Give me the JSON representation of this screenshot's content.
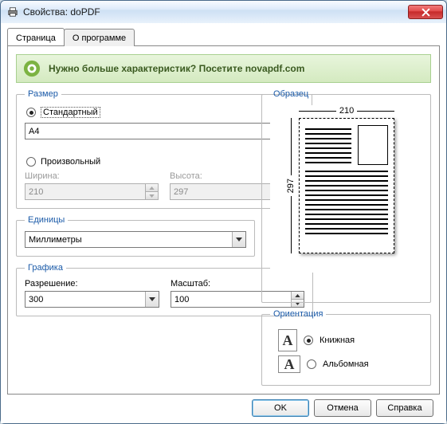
{
  "window": {
    "title": "Свойства: doPDF"
  },
  "tabs": {
    "page": "Страница",
    "about": "О программе"
  },
  "banner": {
    "text": "Нужно больше характеристик? Посетите ",
    "link": "novapdf.com"
  },
  "size": {
    "legend": "Размер",
    "standard_label": "Стандартный",
    "paper": "A4",
    "custom_label": "Произвольный",
    "width_label": "Ширина:",
    "width_value": "210",
    "height_label": "Высота:",
    "height_value": "297"
  },
  "units": {
    "legend": "Единицы",
    "value": "Миллиметры"
  },
  "graphics": {
    "legend": "Графика",
    "resolution_label": "Разрешение:",
    "resolution_value": "300",
    "scale_label": "Масштаб:",
    "scale_value": "100"
  },
  "sample": {
    "legend": "Образец",
    "width": "210",
    "height": "297"
  },
  "orientation": {
    "legend": "Ориентация",
    "portrait": "Книжная",
    "landscape": "Альбомная"
  },
  "buttons": {
    "ok": "OK",
    "cancel": "Отмена",
    "help": "Справка"
  }
}
